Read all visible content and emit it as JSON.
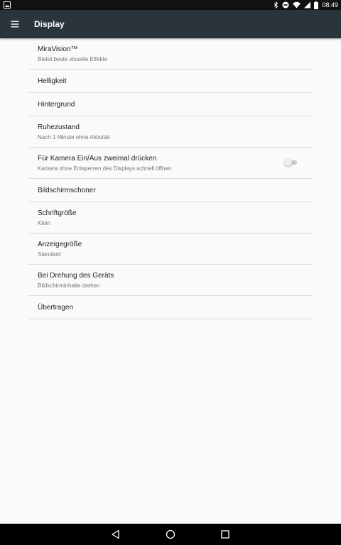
{
  "status_bar": {
    "time": "08:49",
    "icons": [
      "image-notification-icon",
      "bluetooth-icon",
      "do-not-disturb-icon",
      "wifi-icon",
      "cell-signal-icon",
      "battery-icon"
    ]
  },
  "app_bar": {
    "title": "Display",
    "menu_icon": "hamburger-menu-icon"
  },
  "settings": [
    {
      "title": "MiraVision™",
      "summary": "Bietet beste visuelle Effekte"
    },
    {
      "title": "Helligkeit"
    },
    {
      "title": "Hintergrund"
    },
    {
      "title": "Ruhezustand",
      "summary": "Nach 1 Minute ohne Aktivität"
    },
    {
      "title": "Für Kamera Ein/Aus zweimal drücken",
      "summary": "Kamera ohne Entsperren des Displays schnell öffnen",
      "toggle": {
        "on": false,
        "enabled": false
      }
    },
    {
      "title": "Bildschirmschoner"
    },
    {
      "title": "Schriftgröße",
      "summary": "Klein"
    },
    {
      "title": "Anzeigegröße",
      "summary": "Standard"
    },
    {
      "title": "Bei Drehung des Geräts",
      "summary": "Bildschirminhalte drehen"
    },
    {
      "title": "Übertragen"
    }
  ],
  "nav_bar": {
    "icons": [
      "back-icon",
      "home-icon",
      "recents-icon"
    ]
  },
  "colors": {
    "app_bar": "#2b333b",
    "background": "#fafafa",
    "divider": "#dcdcdc",
    "primary_text": "#212121",
    "secondary_text": "#757575"
  }
}
